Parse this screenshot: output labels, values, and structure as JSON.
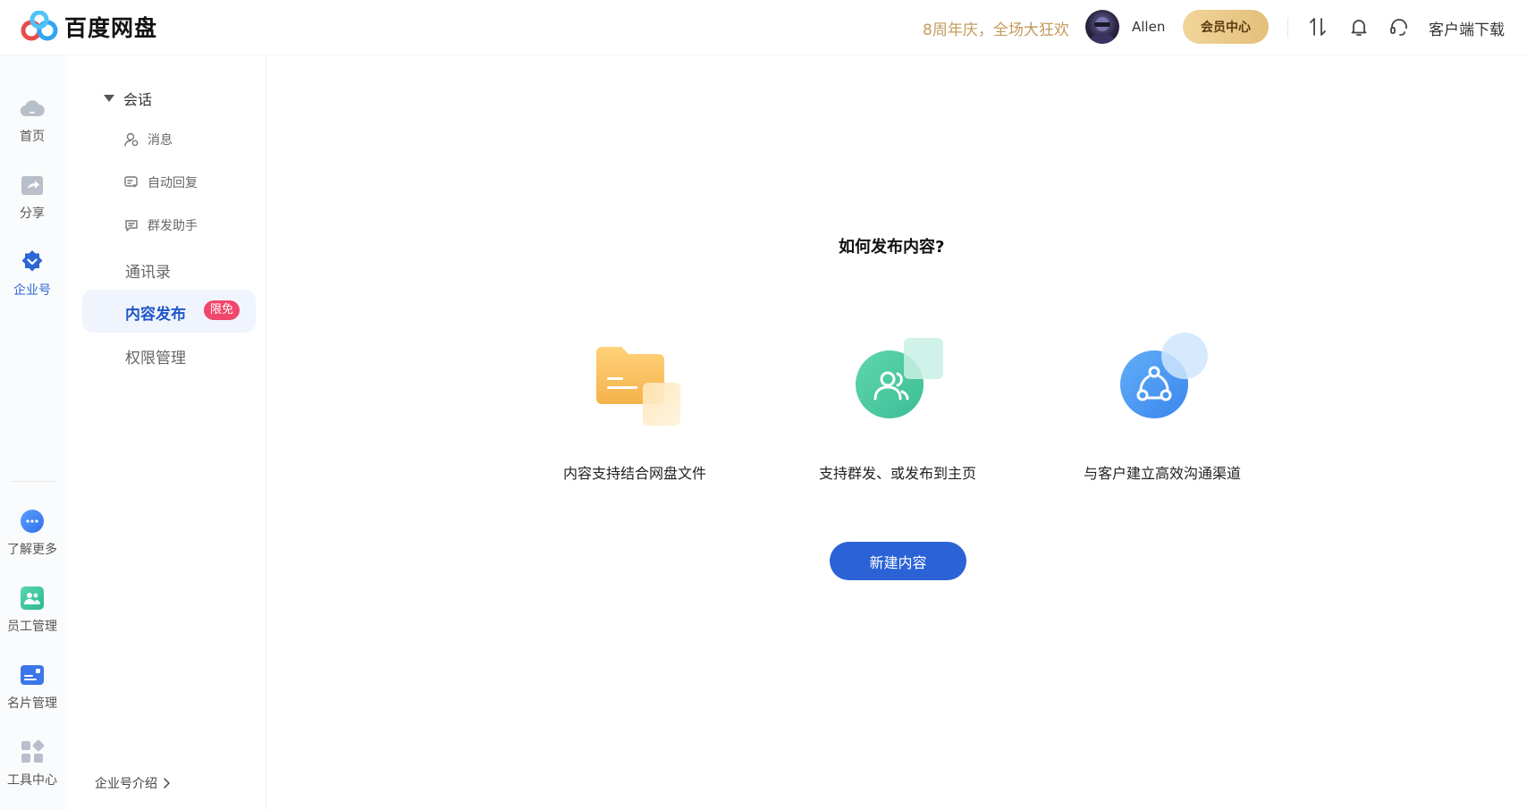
{
  "header": {
    "logo_text": "百度网盘",
    "promo_text": "8周年庆，全场大狂欢",
    "username": "Allen",
    "vip_label": "会员中心",
    "download_label": "客户端下载",
    "icons": [
      "transfer-icon",
      "bell-icon",
      "headset-icon"
    ]
  },
  "rail": {
    "items": [
      {
        "label": "首页",
        "icon": "cloud-icon"
      },
      {
        "label": "分享",
        "icon": "share-icon"
      },
      {
        "label": "企业号",
        "icon": "enterprise-icon",
        "active": true
      },
      {
        "label": "了解更多",
        "icon": "more-icon"
      },
      {
        "label": "员工管理",
        "icon": "staff-icon"
      },
      {
        "label": "名片管理",
        "icon": "card-icon"
      },
      {
        "label": "工具中心",
        "icon": "tools-icon"
      }
    ]
  },
  "sidebar": {
    "group_label": "会话",
    "sub_items": [
      {
        "label": "消息",
        "icon": "user-msg-icon"
      },
      {
        "label": "自动回复",
        "icon": "auto-reply-icon"
      },
      {
        "label": "群发助手",
        "icon": "broadcast-icon"
      }
    ],
    "contacts_label": "通讯录",
    "active_label": "内容发布",
    "active_badge": "限免",
    "permission_label": "权限管理",
    "intro_label": "企业号介绍"
  },
  "main": {
    "title": "如何发布内容?",
    "features": [
      {
        "caption": "内容支持结合网盘文件",
        "icon": "folder-icon"
      },
      {
        "caption": "支持群发、或发布到主页",
        "icon": "group-icon"
      },
      {
        "caption": "与客户建立高效沟通渠道",
        "icon": "share-network-icon"
      }
    ],
    "new_button": "新建内容"
  },
  "colors": {
    "accent": "#2b63d6",
    "promo": "#c49a5c",
    "badge": "#f0476a"
  }
}
